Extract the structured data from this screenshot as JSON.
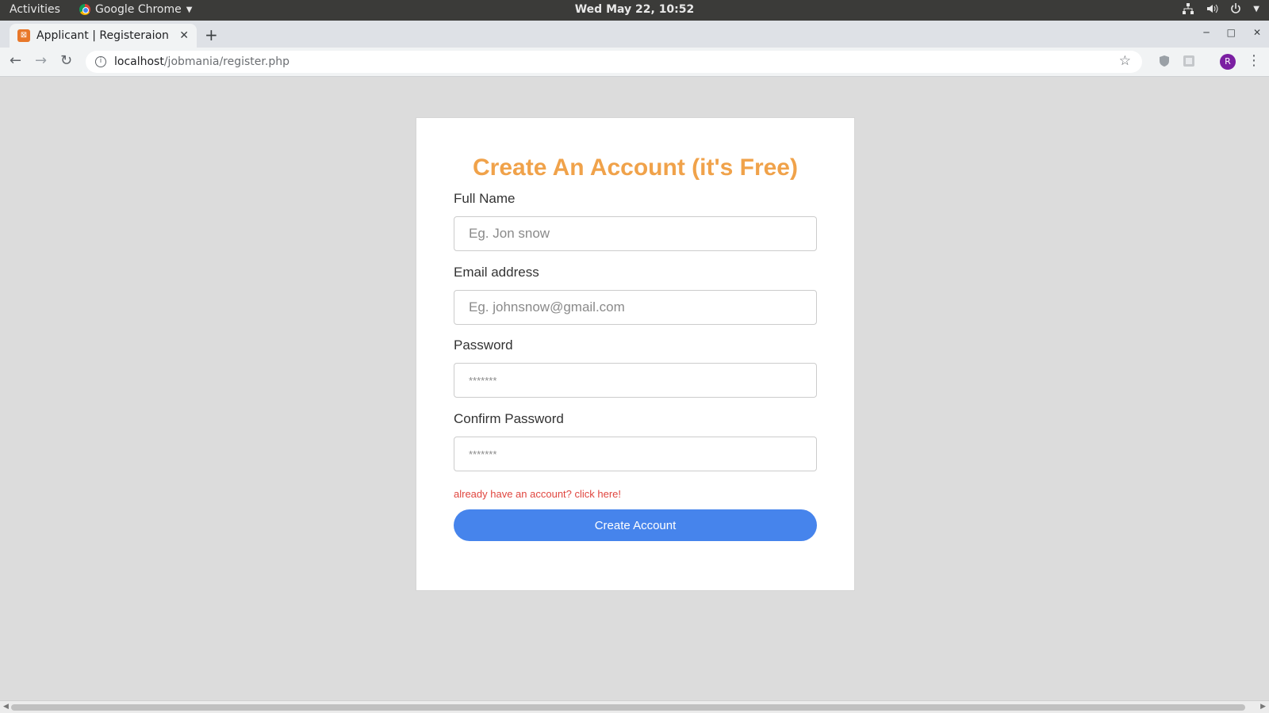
{
  "system": {
    "activities": "Activities",
    "app_name": "Google Chrome",
    "clock": "Wed May 22, 10:52"
  },
  "browser": {
    "tab_title": "Applicant | Registeraion",
    "url_host": "localhost",
    "url_path": "/jobmania/register.php",
    "profile_initial": "R"
  },
  "form": {
    "heading": "Create An Account (it's Free)",
    "fields": [
      {
        "label": "Full Name",
        "placeholder": "Eg. Jon snow"
      },
      {
        "label": "Email address",
        "placeholder": "Eg. johnsnow@gmail.com"
      },
      {
        "label": "Password",
        "placeholder": "*******"
      },
      {
        "label": "Confirm Password",
        "placeholder": "*******"
      }
    ],
    "login_link": "already have an account? click here!",
    "submit_label": "Create Account"
  },
  "colors": {
    "heading": "#f0a24a",
    "link": "#e0463f",
    "button": "#4684ec",
    "page_background": "#dcdcdc"
  }
}
